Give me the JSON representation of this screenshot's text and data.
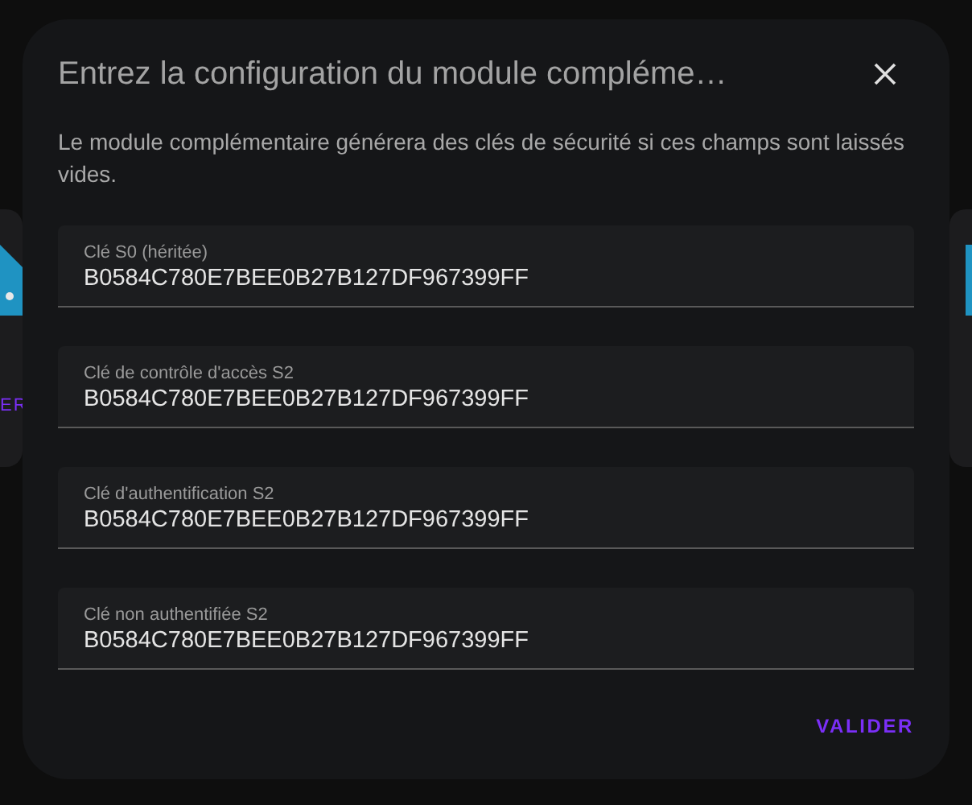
{
  "background": {
    "left_card_text": "ER"
  },
  "dialog": {
    "title": "Entrez la configuration du module compléme…",
    "description": "Le module complémentaire générera des clés de sécurité si ces champs sont laissés vides.",
    "fields": [
      {
        "label": "Clé S0 (héritée)",
        "value": "B0584C780E7BEE0B27B127DF967399FF"
      },
      {
        "label": "Clé de contrôle d'accès S2",
        "value": "B0584C780E7BEE0B27B127DF967399FF"
      },
      {
        "label": "Clé d'authentification S2",
        "value": "B0584C780E7BEE0B27B127DF967399FF"
      },
      {
        "label": "Clé non authentifiée S2",
        "value": "B0584C780E7BEE0B27B127DF967399FF"
      }
    ],
    "buttons": [
      "VALIDER"
    ]
  }
}
